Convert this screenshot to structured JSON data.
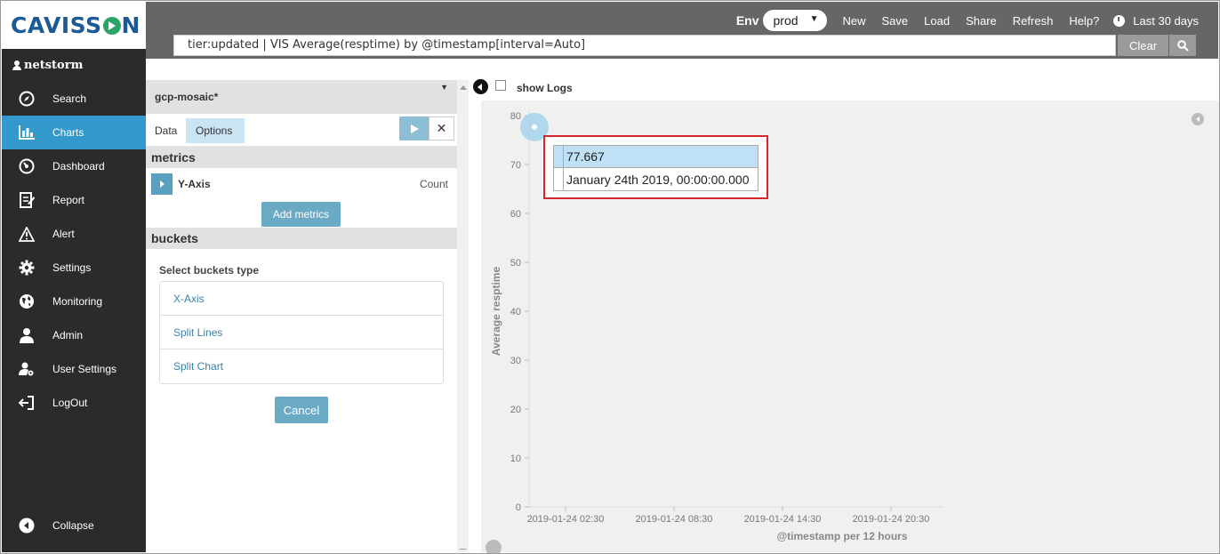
{
  "brand": {
    "logo_text_a": "CAVISS",
    "logo_text_b": "N"
  },
  "header": {
    "env_label": "Env",
    "env_value": "prod",
    "menu": [
      "New",
      "Save",
      "Load",
      "Share",
      "Refresh",
      "Help?"
    ],
    "time_range": "Last 30 days",
    "query": "tier:updated | VIS Average(resptime) by @timestamp[interval=Auto]",
    "clear_label": "Clear"
  },
  "sidebar": {
    "user": "netstorm",
    "items": [
      {
        "label": "Search",
        "icon": "compass-icon"
      },
      {
        "label": "Charts",
        "icon": "bar-chart-icon",
        "active": true
      },
      {
        "label": "Dashboard",
        "icon": "dashboard-icon"
      },
      {
        "label": "Report",
        "icon": "report-icon"
      },
      {
        "label": "Alert",
        "icon": "alert-icon"
      },
      {
        "label": "Settings",
        "icon": "gear-icon"
      },
      {
        "label": "Monitoring",
        "icon": "globe-icon"
      },
      {
        "label": "Admin",
        "icon": "user-icon"
      },
      {
        "label": "User Settings",
        "icon": "user-settings-icon"
      },
      {
        "label": "LogOut",
        "icon": "logout-icon"
      }
    ],
    "collapse_label": "Collapse"
  },
  "editor": {
    "index_name": "gcp-mosaic*",
    "tab_data": "Data",
    "tab_options": "Options",
    "metrics_title": "metrics",
    "metric_label": "Y-Axis",
    "metric_agg": "Count",
    "add_metrics": "Add metrics",
    "buckets_title": "buckets",
    "select_buckets": "Select buckets type",
    "bucket_types": [
      "X-Axis",
      "Split Lines",
      "Split Chart"
    ],
    "cancel": "Cancel"
  },
  "viz": {
    "show_logs": "show Logs",
    "tooltip_value": "77.667",
    "tooltip_time": "January 24th 2019, 00:00:00.000"
  },
  "chart_data": {
    "type": "line",
    "ylabel": "Average resptime",
    "xlabel": "@timestamp per 12 hours",
    "ylim": [
      0,
      80
    ],
    "yticks": [
      0,
      10,
      20,
      30,
      40,
      50,
      60,
      70,
      80
    ],
    "xticks": [
      "2019-01-24 02:30",
      "2019-01-24 08:30",
      "2019-01-24 14:30",
      "2019-01-24 20:30"
    ],
    "series": [
      {
        "x": [
          "2019-01-24 00:00"
        ],
        "values": [
          77.667
        ]
      }
    ],
    "grid": false
  }
}
